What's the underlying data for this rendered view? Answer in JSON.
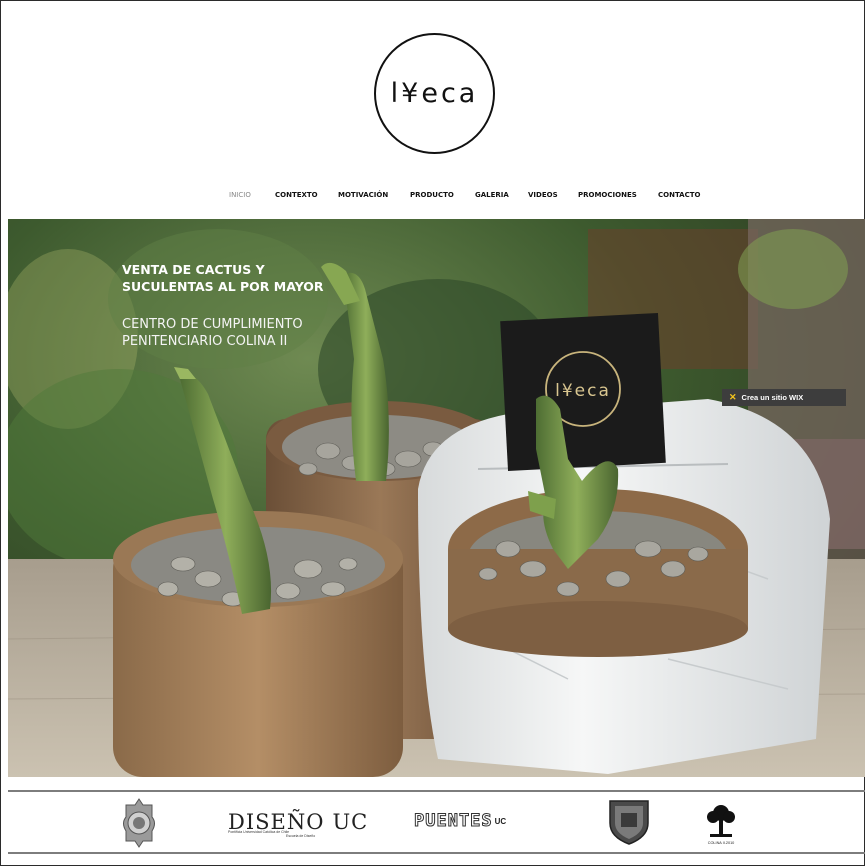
{
  "header": {
    "logo_text": "l¥eca"
  },
  "nav": {
    "items": [
      {
        "label": "INICIO",
        "active": true
      },
      {
        "label": "CONTEXTO",
        "active": false
      },
      {
        "label": "MOTIVACIÓN",
        "active": false
      },
      {
        "label": "PRODUCTO",
        "active": false
      },
      {
        "label": "GALERIA",
        "active": false
      },
      {
        "label": "VIDEOS",
        "active": false
      },
      {
        "label": "PROMOCIONES",
        "active": false
      },
      {
        "label": "CONTACTO",
        "active": false
      }
    ]
  },
  "hero": {
    "title_line1": "VENTA DE CACTUS Y",
    "title_line2": "SUCULENTAS AL POR MAYOR",
    "subtitle_line1": "CENTRO DE CUMPLIMIENTO",
    "subtitle_line2": "PENITENCIARIO COLINA II",
    "sign_logo_text": "l¥eca"
  },
  "wix_badge": {
    "icon": "wix-x-icon",
    "label": "Crea un sitio WIX"
  },
  "footer": {
    "diseno_logo": "DISEÑO",
    "diseno_uc": "UC",
    "diseno_caption_1": "Pontificia Universidad Católica de Chile",
    "diseno_caption_2": "Escuela de Diseño",
    "puentes_logo": "PUENTES",
    "puentes_uc": "UC",
    "colina_caption": "COLINA II.2010"
  },
  "colors": {
    "nav_active": "#888888",
    "nav_text": "#111111",
    "wix_badge_bg": "#3d3d3d",
    "wix_accent": "#f6c61c",
    "footer_rule": "#7d7d7d"
  }
}
